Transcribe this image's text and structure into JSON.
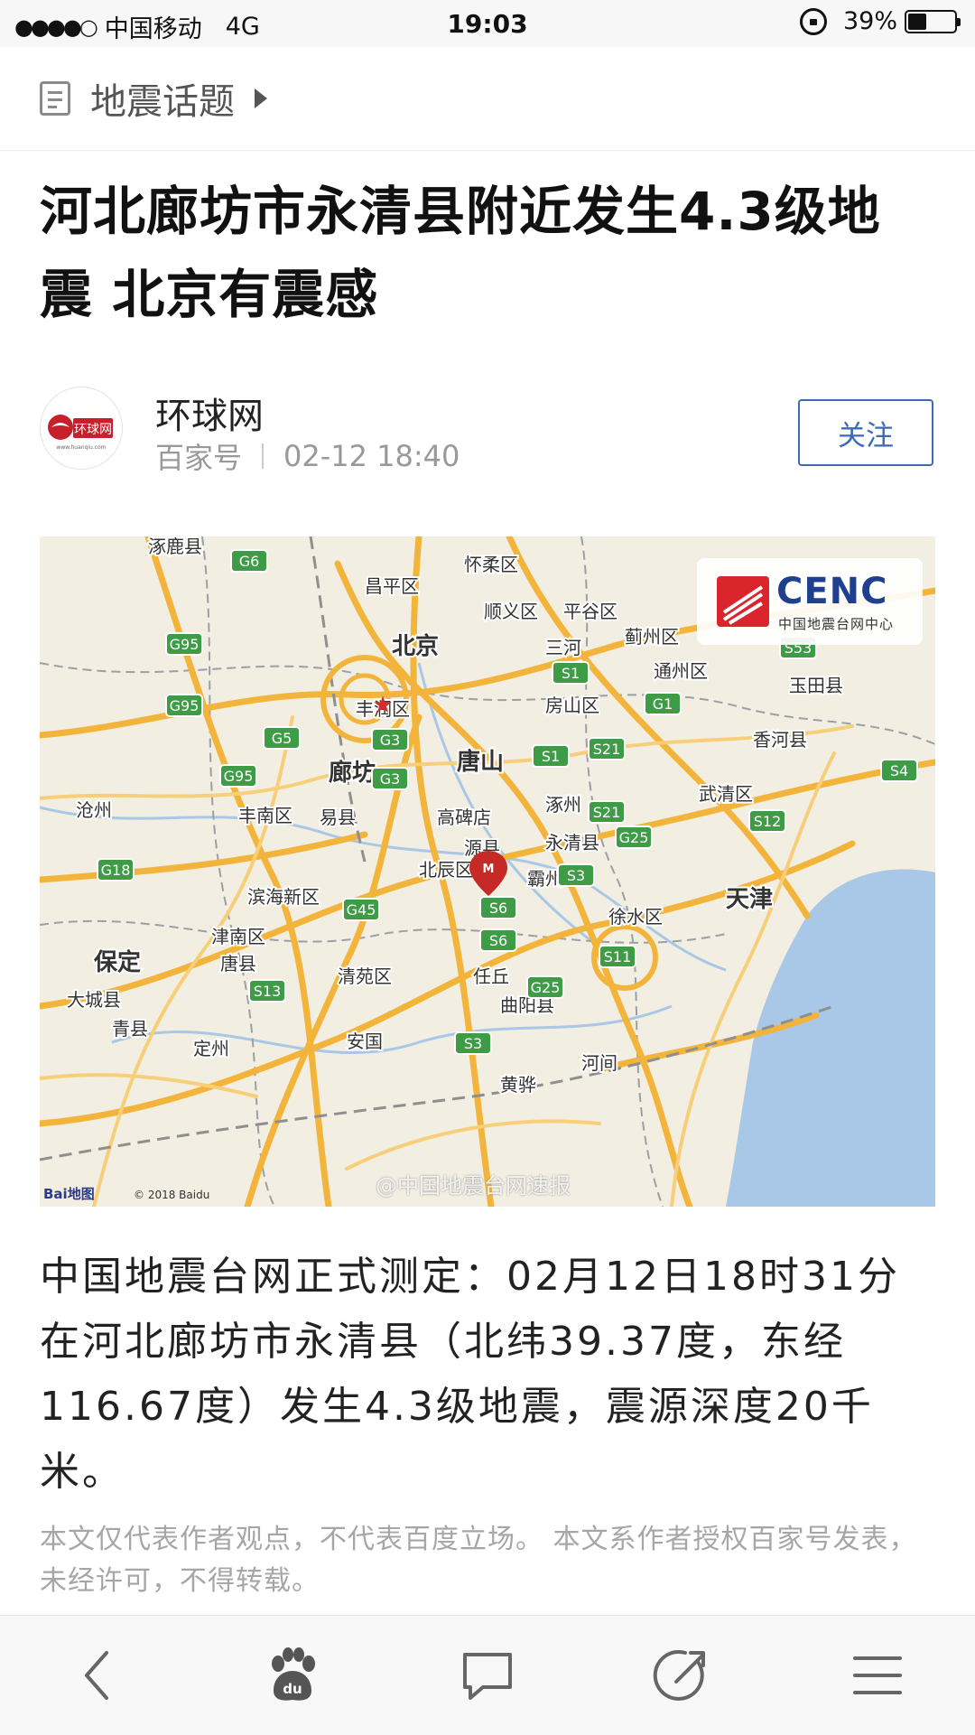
{
  "status_bar": {
    "signal_dots": "●●●●○",
    "carrier": "中国移动",
    "network": "4G",
    "time": "19:03",
    "battery_percent": "39%",
    "battery_level": 0.39
  },
  "topic": {
    "label": "地震话题",
    "icon": "document-icon"
  },
  "article": {
    "title": "河北廊坊市永清县附近发生4.3级地震 北京有震感",
    "author": {
      "name": "环球网",
      "platform": "百家号",
      "date": "02-12 18:40",
      "avatar_logo_text": "环球网",
      "avatar_logo_sub": "www.huanqiu.com"
    },
    "follow_label": "关注",
    "map": {
      "logo_text": "CENC",
      "logo_sub": "中国地震台网中心",
      "attribution": "© 2018 Baidu",
      "baidu_mark": "Bai地图",
      "watermark": "@中国地震台网速报",
      "epicenter_marker": "M",
      "place_labels": [
        "涿鹿县",
        "怀柔区",
        "昌平区",
        "顺义区",
        "平谷区",
        "蓟州区",
        "北京",
        "三河",
        "通州区",
        "玉田县",
        "丰润区",
        "房山区",
        "香河县",
        "唐山",
        "廊坊",
        "涿州",
        "武清区",
        "丰南区",
        "易县",
        "高碑店",
        "永清县",
        "北辰区",
        "霸州",
        "天津",
        "滨海新区",
        "徐水区",
        "津南区",
        "保定",
        "唐县",
        "清苑区",
        "任丘",
        "大城县",
        "曲阳县",
        "青县",
        "定州",
        "安国",
        "河间",
        "黄骅",
        "沧州",
        "源县"
      ],
      "highway_labels": [
        "G6",
        "G95",
        "G95",
        "G5",
        "G95",
        "G3",
        "G3",
        "S1",
        "S1",
        "G1",
        "S53",
        "S21",
        "S21",
        "G25",
        "S12",
        "S4",
        "G18",
        "G45",
        "S6",
        "S6",
        "S3",
        "S11",
        "S13",
        "G25",
        "S3"
      ]
    },
    "body": "中国地震台网正式测定：02月12日18时31分在河北廊坊市永清县（北纬39.37度，东经116.67度）发生4.3级地震，震源深度20千米。",
    "disclaimer": "本文仅代表作者观点，不代表百度立场。 本文系作者授权百家号发表，未经许可，不得转载。"
  },
  "bottom_nav": [
    "back-icon",
    "baidu-paw-icon",
    "comment-icon",
    "share-icon",
    "menu-icon"
  ]
}
